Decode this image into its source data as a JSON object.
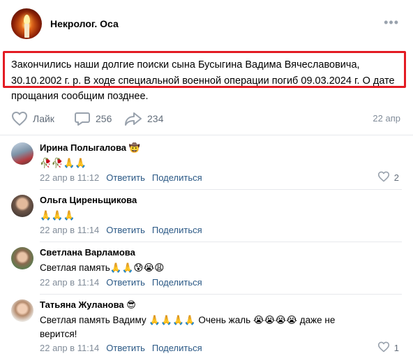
{
  "post": {
    "group_name": "Некролог. Оса",
    "text": "Закончились наши долгие поиски сына Бусыгина Вадима Вячеславовича, 30.10.2002 г. р. В ходе специальной военной операции погиб 09.03.2024 г. О дате прощания сообщим позднее.",
    "like_label": "Лайк",
    "comments_count": "256",
    "shares_count": "234",
    "date": "22 апр"
  },
  "comments": [
    {
      "author": "Ирина Полыгалова 🤠",
      "text": "🥀🥀🙏🙏",
      "time": "22 апр в 11:12",
      "reply": "Ответить",
      "share": "Поделиться",
      "likes": "2"
    },
    {
      "author": "Ольга Циреньщикова",
      "text": "🙏🙏🙏",
      "time": "22 апр в 11:14",
      "reply": "Ответить",
      "share": "Поделиться",
      "likes": ""
    },
    {
      "author": "Светлана Варламова",
      "text": "Светлая память🙏🙏😰😭😩",
      "time": "22 апр в 11:14",
      "reply": "Ответить",
      "share": "Поделиться",
      "likes": ""
    },
    {
      "author": "Татьяна Жуланова 😎",
      "text": "Светлая память Вадиму 🙏🙏🙏🙏 Очень жаль 😭😭😭😭 даже не верится!",
      "time": "22 апр в 11:14",
      "reply": "Ответить",
      "share": "Поделиться",
      "likes": "1"
    }
  ],
  "colors": {
    "accent_link": "#2a5885",
    "highlight_border": "#e31b23",
    "meta": "#818c99"
  },
  "icons": [
    "more-icon",
    "heart-icon",
    "comment-icon",
    "share-icon"
  ]
}
